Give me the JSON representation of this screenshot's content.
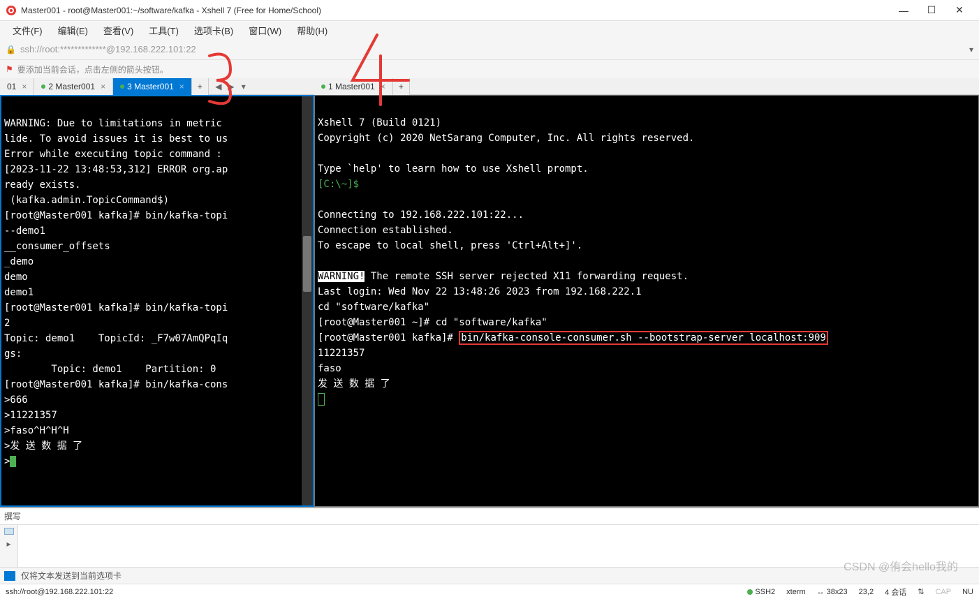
{
  "window": {
    "title": "Master001 - root@Master001:~/software/kafka - Xshell 7 (Free for Home/School)"
  },
  "menu": {
    "file": "文件(F)",
    "edit": "编辑(E)",
    "view": "查看(V)",
    "tools": "工具(T)",
    "tabs": "选项卡(B)",
    "window": "窗口(W)",
    "help": "帮助(H)"
  },
  "address": {
    "url": "ssh://root:*************@192.168.222.101:22"
  },
  "hint": {
    "text": "要添加当前会话，点击左侧的箭头按钮。"
  },
  "leftPane": {
    "tabs": {
      "t0_label": "01",
      "t1_label": "2 Master001",
      "t2_label": "3 Master001"
    },
    "terminal": {
      "l1": "WARNING: Due to limitations in metric",
      "l2": "lide. To avoid issues it is best to us",
      "l3": "Error while executing topic command : ",
      "l4": "[2023-11-22 13:48:53,312] ERROR org.ap",
      "l5": "ready exists.",
      "l6": " (kafka.admin.TopicCommand$)",
      "l7": "[root@Master001 kafka]# bin/kafka-topi",
      "l8": "--demo1",
      "l9": "__consumer_offsets",
      "l10": "_demo",
      "l11": "demo",
      "l12": "demo1",
      "l13": "[root@Master001 kafka]# bin/kafka-topi",
      "l14": "2",
      "l15": "Topic: demo1    TopicId: _F7w07AmQPqIq",
      "l16": "gs: ",
      "l17": "        Topic: demo1    Partition: 0  ",
      "l18": "[root@Master001 kafka]# bin/kafka-cons",
      "l19": ">666",
      "l20": ">11221357",
      "l21": ">faso^H^H^H",
      "l22": ">发 送 数 据 了",
      "l23": ">"
    }
  },
  "rightPane": {
    "tabs": {
      "t0_label": "1 Master001"
    },
    "terminal": {
      "l1": "Xshell 7 (Build 0121)",
      "l2": "Copyright (c) 2020 NetSarang Computer, Inc. All rights reserved.",
      "l3": "",
      "l4": "Type `help' to learn how to use Xshell prompt.",
      "l5a": "[C:\\~]$",
      "l6": "",
      "l7": "Connecting to 192.168.222.101:22...",
      "l8": "Connection established.",
      "l9": "To escape to local shell, press 'Ctrl+Alt+]'.",
      "l10": "",
      "l11a": "WARNING!",
      "l11b": " The remote SSH server rejected X11 forwarding request.",
      "l12": "Last login: Wed Nov 22 13:48:26 2023 from 192.168.222.1",
      "l13": "cd \"software/kafka\"",
      "l14": "[root@Master001 ~]# cd \"software/kafka\"",
      "l15a": "[root@Master001 kafka]# ",
      "l15b": "bin/kafka-console-consumer.sh --bootstrap-server localhost:909",
      "l16": "11221357",
      "l17": "faso",
      "l18": "发 送 数 据 了"
    }
  },
  "compose": {
    "label": "撰写",
    "footer": "仅将文本发送到当前选项卡"
  },
  "status": {
    "conn": "ssh://root@192.168.222.101:22",
    "proto": "SSH2",
    "term": "xterm",
    "size": "38x23",
    "pos": "23,2",
    "sessions": "4 会话",
    "cap": "CAP",
    "num": "NU"
  },
  "annotations": {
    "a3": "3",
    "a4": "4"
  },
  "watermark": "CSDN @侑会hello我的"
}
